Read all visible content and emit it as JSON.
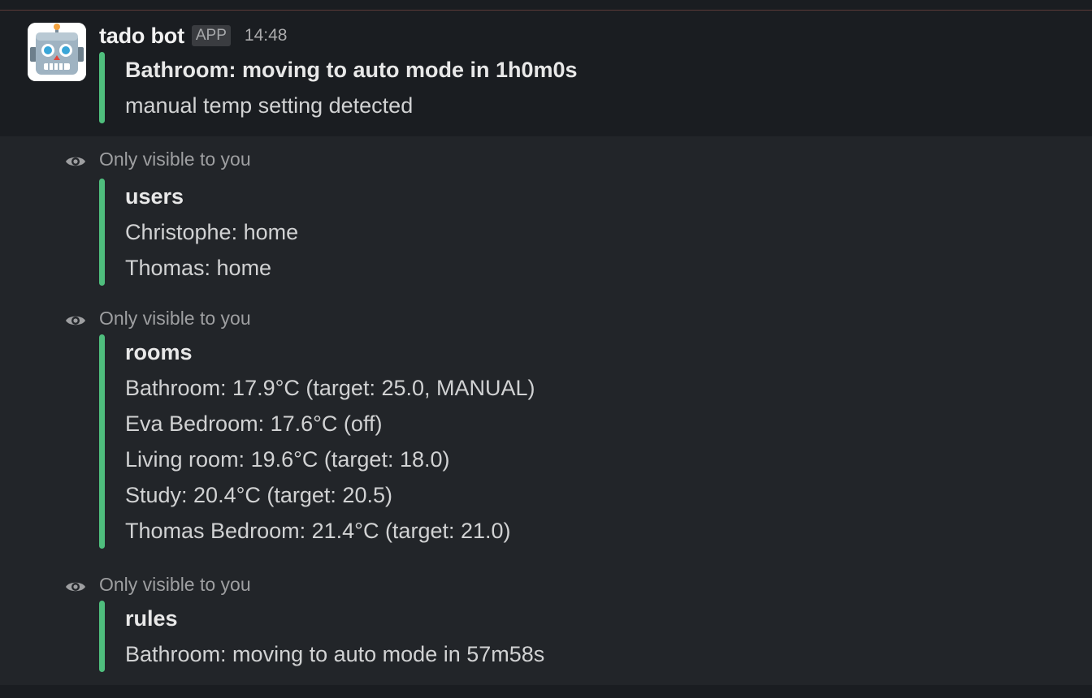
{
  "message": {
    "sender": "tado bot",
    "badge": "APP",
    "time": "14:48",
    "avatar_icon": "robot-face",
    "attachment": {
      "title": "Bathroom: moving to auto mode in 1h0m0s",
      "lines": [
        "manual temp setting detected"
      ]
    }
  },
  "ephemeral_label": "Only visible to you",
  "ephemeral_messages": [
    {
      "title": "users",
      "lines": [
        "Christophe: home",
        "Thomas: home"
      ]
    },
    {
      "title": "rooms",
      "lines": [
        "Bathroom: 17.9°C (target: 25.0, MANUAL)",
        "Eva Bedroom: 17.6°C (off)",
        "Living room: 19.6°C (target: 18.0)",
        "Study: 20.4°C (target: 20.5)",
        "Thomas Bedroom: 21.4°C (target: 21.0)"
      ]
    },
    {
      "title": "rules",
      "lines": [
        "Bathroom: moving to auto mode in 57m58s"
      ]
    }
  ],
  "colors": {
    "background": "#1a1d21",
    "ephemeral_background": "#222529",
    "attachment_bar": "#4fbe7d"
  }
}
